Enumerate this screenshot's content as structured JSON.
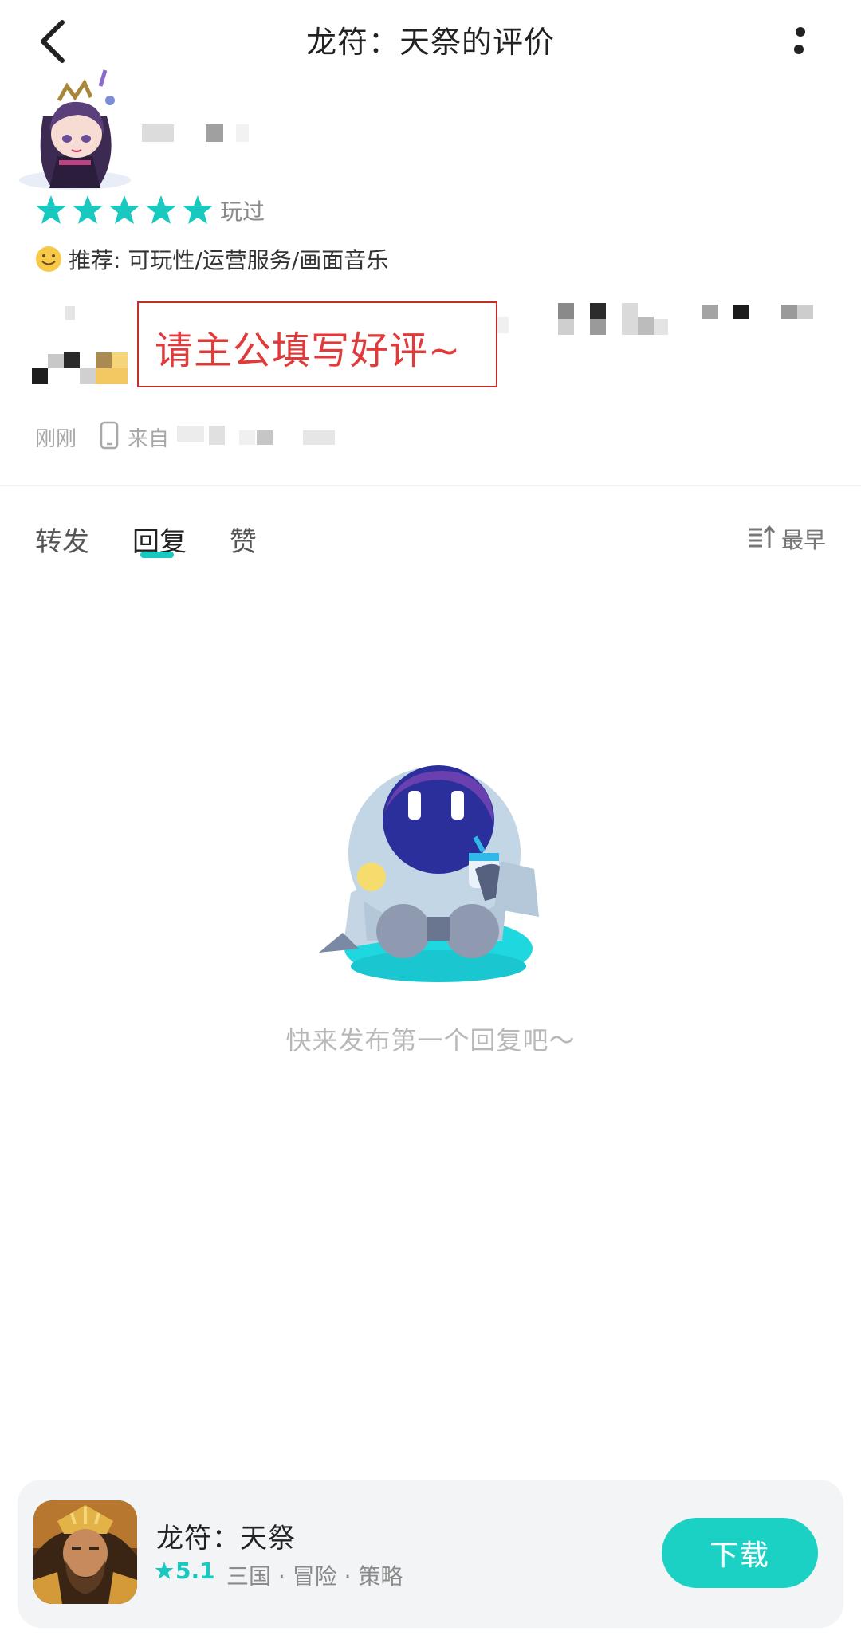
{
  "header": {
    "title": "龙符：天祭的评价"
  },
  "review": {
    "played_label": "玩过",
    "recommend_text": "推荐: 可玩性/运营服务/画面音乐",
    "highlight_text": "请主公填写好评~",
    "time": "刚刚",
    "from_label": "来自"
  },
  "rating_stars": 5,
  "tabs": [
    {
      "label": "转发"
    },
    {
      "label": "回复"
    },
    {
      "label": "赞"
    }
  ],
  "sort": {
    "label": "最早"
  },
  "empty_state": {
    "text": "快来发布第一个回复吧～"
  },
  "game": {
    "name": "龙符：天祭",
    "rating": "5.1",
    "tags": "三国 · 冒险 · 策略",
    "download_label": "下载"
  },
  "colors": {
    "accent": "#19c9c0",
    "highlight_red": "#e03a3a"
  }
}
